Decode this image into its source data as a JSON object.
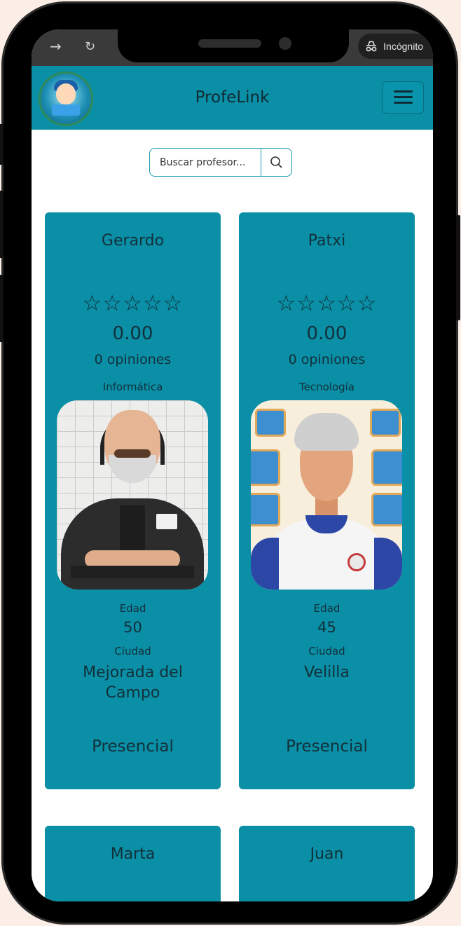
{
  "browser": {
    "back_icon": "arrow-right-icon",
    "reload_icon": "reload-icon",
    "incognito_label": "Incógnito"
  },
  "navbar": {
    "brand": "ProfeLink"
  },
  "search": {
    "placeholder": "Buscar profesor..."
  },
  "teachers": [
    {
      "name": "Gerardo",
      "stars": "☆☆☆☆☆",
      "rating": "0.00",
      "opinions": "0 opiniones",
      "subject": "Informática",
      "age_label": "Edad",
      "age": "50",
      "city_label": "Ciudad",
      "city": "Mejorada del Campo",
      "mode": "Presencial"
    },
    {
      "name": "Patxi",
      "stars": "☆☆☆☆☆",
      "rating": "0.00",
      "opinions": "0 opiniones",
      "subject": "Tecnología",
      "age_label": "Edad",
      "age": "45",
      "city_label": "Ciudad",
      "city": "Velilla",
      "mode": "Presencial"
    },
    {
      "name": "Marta"
    },
    {
      "name": "Juan"
    }
  ],
  "colors": {
    "primary": "#0a8fa6",
    "page_background": "#fbeee6"
  }
}
